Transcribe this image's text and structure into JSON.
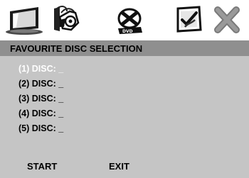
{
  "menu_icons": [
    {
      "name": "tv-display-icon"
    },
    {
      "name": "audio-speaker-icon"
    },
    {
      "name": "disc-feature-icon"
    },
    {
      "name": "preferences-check-icon"
    },
    {
      "name": "close-x-icon"
    }
  ],
  "header": {
    "title": "FAVOURITE DISC SELECTION"
  },
  "list": {
    "items": [
      {
        "label": "(1) DISC: _",
        "selected": true
      },
      {
        "label": "(2) DISC: _",
        "selected": false
      },
      {
        "label": "(3) DISC: _",
        "selected": false
      },
      {
        "label": "(4) DISC: _",
        "selected": false
      },
      {
        "label": "(5) DISC: _",
        "selected": false
      }
    ]
  },
  "footer": {
    "start_label": "START",
    "exit_label": "EXIT"
  },
  "colors": {
    "panel_background": "#c5c5c5",
    "title_bar": "#8f8f8f",
    "selected_text": "#ffffff",
    "normal_text": "#000000",
    "icon_bar_background": "#ffffff"
  }
}
